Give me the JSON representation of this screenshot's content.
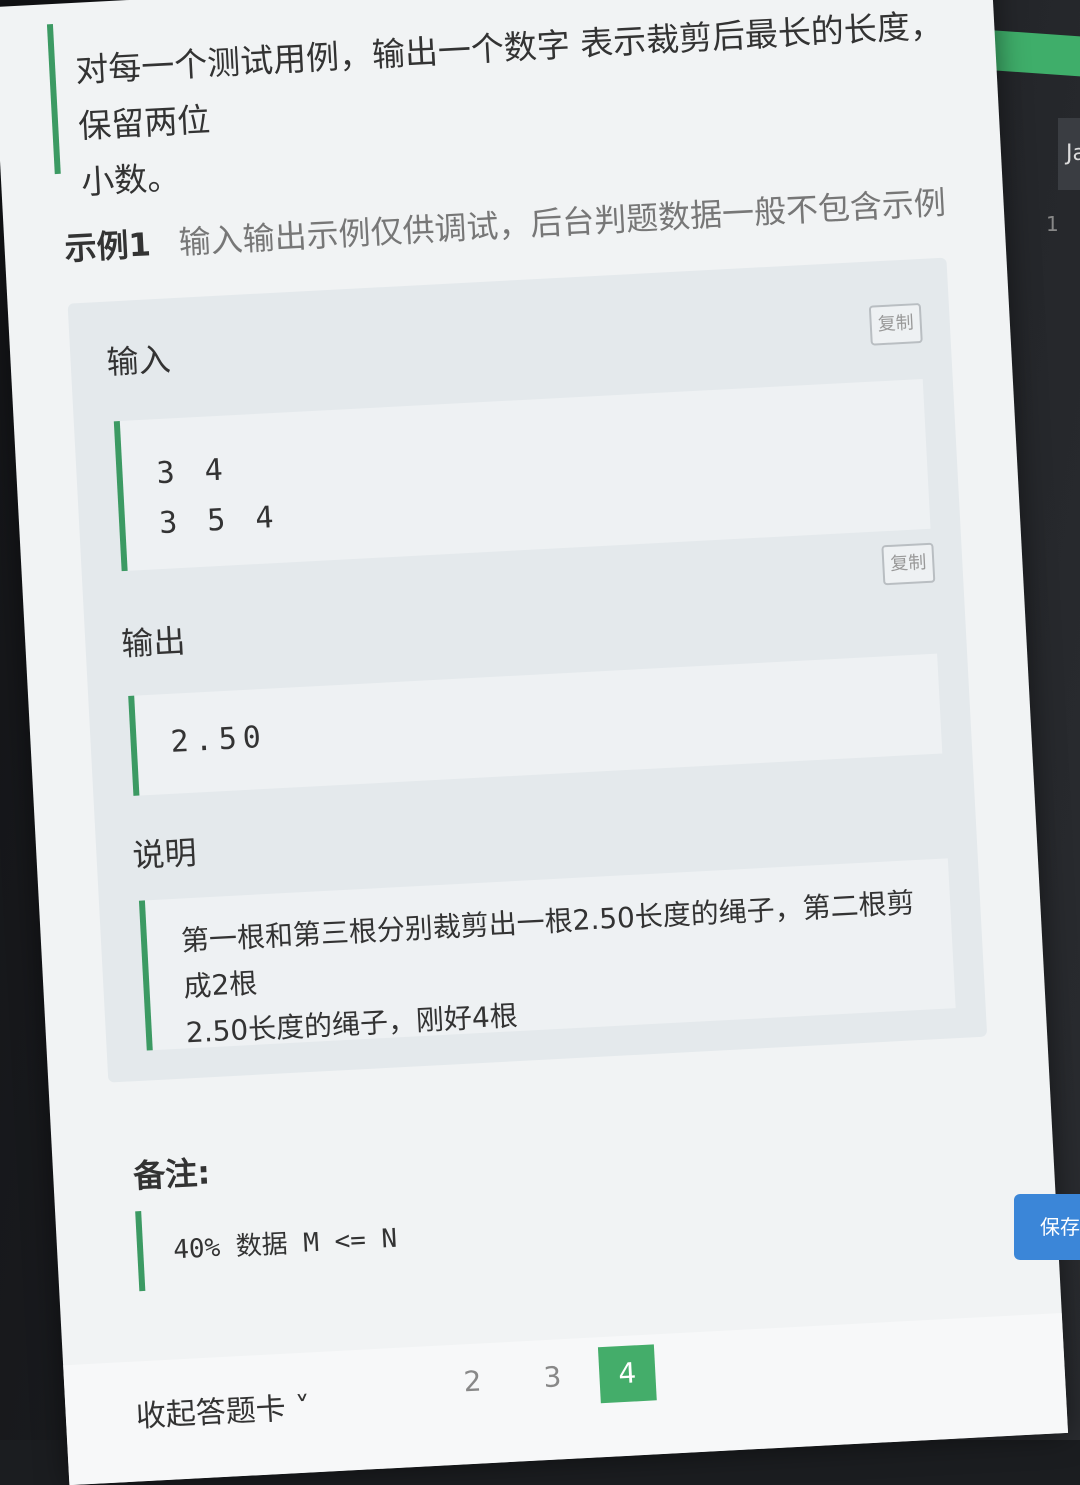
{
  "description": {
    "line1": "对每一个测试用例，输出一个数字 表示裁剪后最长的长度，保留两位",
    "line2": "小数。"
  },
  "example": {
    "title": "示例1",
    "hint": "输入输出示例仅供调试，后台判题数据一般不包含示例",
    "input_label": "输入",
    "input_lines": [
      "3 4",
      "3 5 4"
    ],
    "output_label": "输出",
    "output_value": "2.50",
    "copy_label": "复制",
    "explain_label": "说明",
    "explain_line1": "第一根和第三根分别裁剪出一根2.50长度的绳子，第二根剪成2根",
    "explain_line2": "2.50长度的绳子，刚好4根"
  },
  "note": {
    "label": "备注:",
    "text": "40% 数据 M <= N"
  },
  "answer_card": {
    "collapse_label": "收起答题卡 ˅",
    "questions": [
      "2",
      "3",
      "4"
    ],
    "active": "4"
  },
  "editor": {
    "tab_fragment": "Ja",
    "line_number": "1",
    "save_label": "保存"
  },
  "colors": {
    "accent_green": "#3c9a63",
    "save_blue": "#3b86d8"
  }
}
